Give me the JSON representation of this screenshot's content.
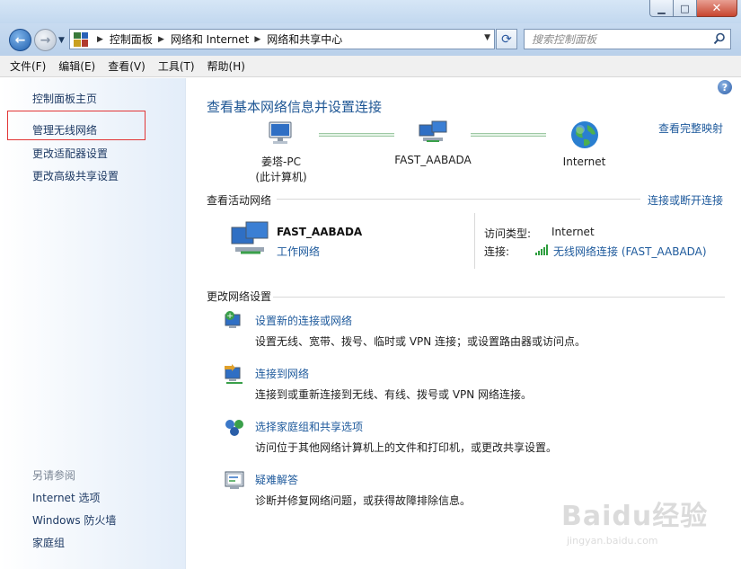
{
  "window": {
    "min_symbol": "▁",
    "max_symbol": "□",
    "close_symbol": "✕"
  },
  "address": {
    "crumbs": [
      "控制面板",
      "网络和 Internet",
      "网络和共享中心"
    ],
    "search_placeholder": "搜索控制面板"
  },
  "menu": [
    "文件(F)",
    "编辑(E)",
    "查看(V)",
    "工具(T)",
    "帮助(H)"
  ],
  "sidebar": {
    "links": [
      "控制面板主页",
      "管理无线网络",
      "更改适配器设置",
      "更改高级共享设置"
    ],
    "see_also_heading": "另请参阅",
    "see_also": [
      "Internet 选项",
      "Windows 防火墙",
      "家庭组"
    ]
  },
  "main": {
    "title": "查看基本网络信息并设置连接",
    "full_map_link": "查看完整映射",
    "map": {
      "computer_name": "姜塔-PC",
      "computer_sub": "(此计算机)",
      "router_name": "FAST_AABADA",
      "internet_name": "Internet"
    },
    "active": {
      "heading": "查看活动网络",
      "connect_link": "连接或断开连接",
      "network_name": "FAST_AABADA",
      "network_type": "工作网络",
      "access_type_label": "访问类型:",
      "access_type_value": "Internet",
      "connection_label": "连接:",
      "connection_value": "无线网络连接 (FAST_AABADA)"
    },
    "change": {
      "heading": "更改网络设置",
      "tasks": [
        {
          "link": "设置新的连接或网络",
          "desc": "设置无线、宽带、拨号、临时或 VPN 连接；或设置路由器或访问点。",
          "icon": "new-connection-icon"
        },
        {
          "link": "连接到网络",
          "desc": "连接到或重新连接到无线、有线、拨号或 VPN 网络连接。",
          "icon": "connect-network-icon"
        },
        {
          "link": "选择家庭组和共享选项",
          "desc": "访问位于其他网络计算机上的文件和打印机，或更改共享设置。",
          "icon": "homegroup-icon"
        },
        {
          "link": "疑难解答",
          "desc": "诊断并修复网络问题，或获得故障排除信息。",
          "icon": "troubleshoot-icon"
        }
      ]
    }
  },
  "watermark": {
    "logo_text": "Baidu经验",
    "url_text": "jingyan.baidu.com"
  },
  "colors": {
    "link": "#1e5a9c",
    "title": "#1e5694",
    "highlight_box": "#e23535"
  }
}
